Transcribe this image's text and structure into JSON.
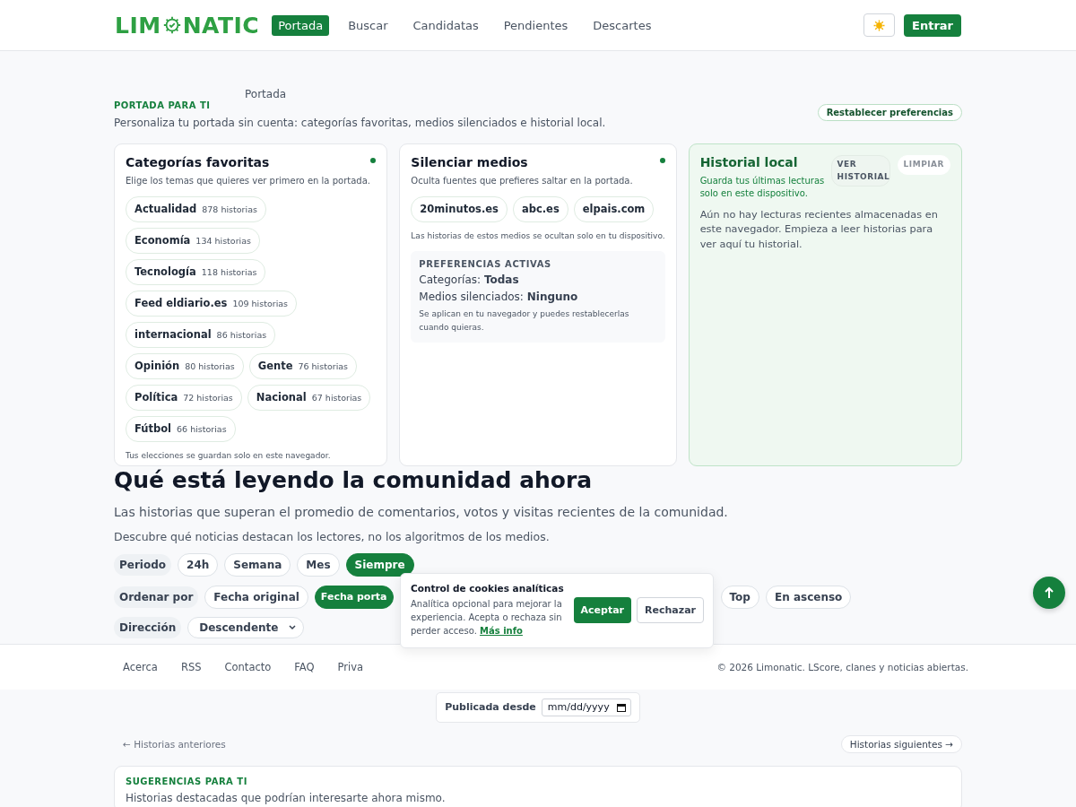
{
  "header": {
    "logo": {
      "before": "LIM",
      "after": "NATIC"
    },
    "nav": [
      {
        "label": "Portada",
        "selected": true
      },
      {
        "label": "Buscar",
        "selected": false
      },
      {
        "label": "Candidatas",
        "selected": false
      },
      {
        "label": "Pendientes",
        "selected": false
      },
      {
        "label": "Descartes",
        "selected": false
      }
    ],
    "login": "Entrar"
  },
  "breadcrumb": "Portada",
  "intro": {
    "eyebrow": "PORTADA PARA TI",
    "text": "Personaliza tu portada sin cuenta: categorías favoritas, medios silenciados e historial local.",
    "reset": "Restablecer preferencias"
  },
  "favorites": {
    "title": "Categorías favoritas",
    "active": true,
    "subtitle": "Elige los temas que quieres ver primero en la portada.",
    "categories": [
      {
        "name": "Actualidad",
        "count": "878 historias"
      },
      {
        "name": "Economía",
        "count": "134 historias"
      },
      {
        "name": "Tecnología",
        "count": "118 historias"
      },
      {
        "name": "Feed eldiario.es",
        "count": "109 historias"
      },
      {
        "name": "internacional",
        "count": "86 historias"
      },
      {
        "name": "Opinión",
        "count": "80 historias"
      },
      {
        "name": "Gente",
        "count": "76 historias"
      },
      {
        "name": "Política",
        "count": "72 historias"
      },
      {
        "name": "Nacional",
        "count": "67 historias"
      },
      {
        "name": "Fútbol",
        "count": "66 historias"
      }
    ],
    "note": "Tus elecciones se guardan solo en este navegador."
  },
  "mute": {
    "title": "Silenciar medios",
    "active": true,
    "subtitle": "Oculta fuentes que prefieres saltar en la portada.",
    "sources": [
      "20minutos.es",
      "abc.es",
      "elpais.com"
    ],
    "note": "Las historias de estos medios se ocultan solo en tu dispositivo.",
    "active_prefs": {
      "title": "PREFERENCIAS ACTIVAS",
      "lines": [
        "Categorías: **Todas**",
        "Medios silenciados: **Ninguno**"
      ],
      "note": "Se aplican en tu navegador y puedes restablecerlas cuando quieras."
    }
  },
  "history": {
    "title": "Historial local",
    "subtitle": "Guarda tus últimas lecturas solo en este dispositivo.",
    "buttons": [
      {
        "label": "VER HISTORIAL",
        "disabled": false
      },
      {
        "label": "LIMPIAR",
        "disabled": true
      }
    ],
    "empty": "Aún no hay lecturas recientes almacenadas en este navegador. Empieza a leer historias para ver aquí tu historial."
  },
  "community": {
    "title": "Qué está leyendo la comunidad ahora",
    "subtitle": "Las historias que superan el promedio de comentarios, votos y visitas recientes de la comunidad.",
    "text": "Descubre qué noticias destacan los lectores, no los algoritmos de los medios.",
    "period": {
      "label": "Periodo",
      "options": [
        {
          "label": "24h",
          "selected": false
        },
        {
          "label": "Semana",
          "selected": false
        },
        {
          "label": "Mes",
          "selected": false
        },
        {
          "label": "Siempre",
          "selected": true
        }
      ]
    },
    "sort": {
      "label": "Ordenar por",
      "options": [
        {
          "label": "Fecha original",
          "selected": false
        },
        {
          "label": "Fecha porta",
          "selected": true
        }
      ],
      "options_after": [
        {
          "label": "Top",
          "selected": false
        },
        {
          "label": "En ascenso",
          "selected": false
        }
      ]
    },
    "direction": {
      "label": "Dirección",
      "value": "Descendente"
    },
    "date": {
      "label": "Publicada desde",
      "placeholder": "mm/dd/yyyy"
    },
    "prev": "← Historias anteriores",
    "next": "Historias siguientes →"
  },
  "footer": {
    "links": [
      "Acerca",
      "RSS",
      "Contacto",
      "FAQ",
      "Priva"
    ],
    "copyright": "© 2026 Limonatic. LScore, clanes y noticias abiertas."
  },
  "cookies": {
    "title": "Control de cookies analíticas",
    "text": "Analítica opcional para mejorar la experiencia. Acepta o rechaza sin perder acceso.",
    "link": "Más info",
    "accept": "Aceptar",
    "reject": "Rechazar"
  },
  "suggestions": {
    "eyebrow": "SUGERENCIAS PARA TI",
    "text": "Historias destacadas que podrían interesarte ahora mismo."
  }
}
